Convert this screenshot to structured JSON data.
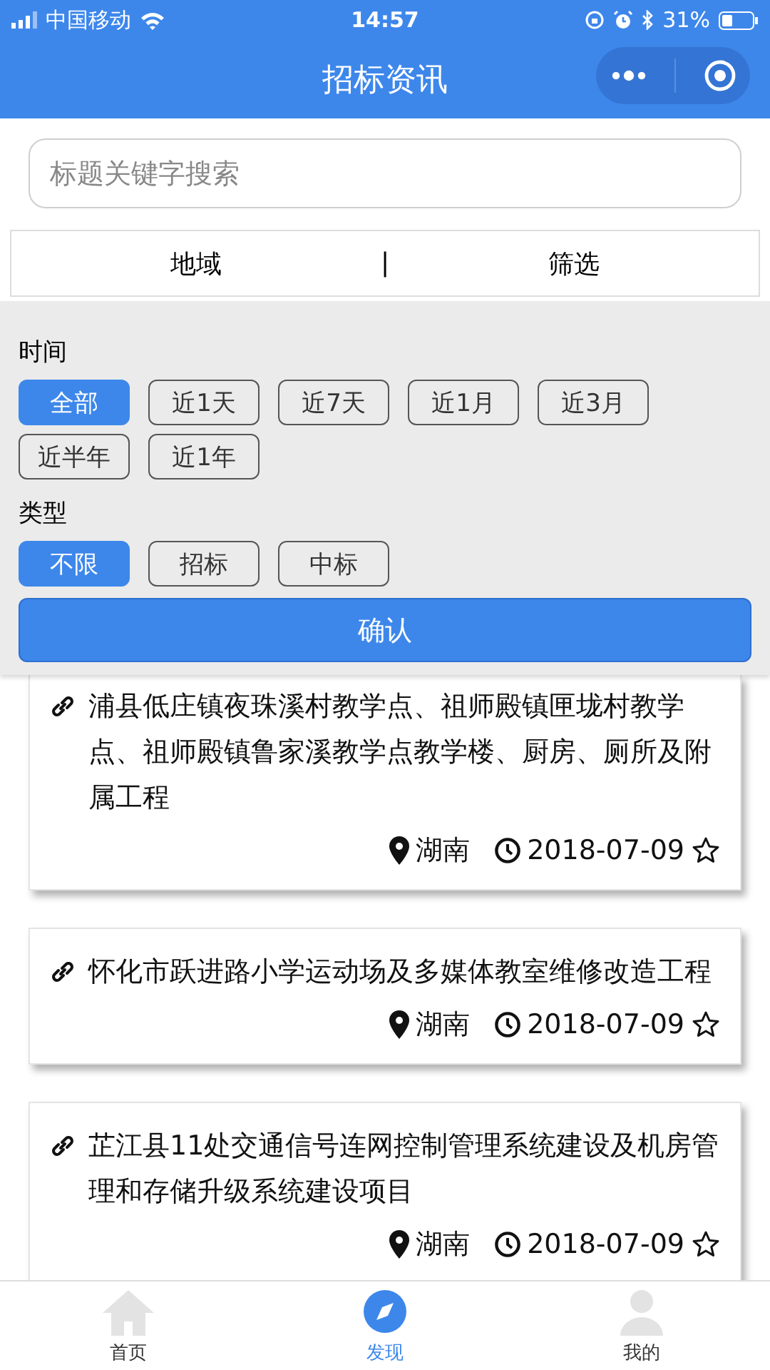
{
  "status_bar": {
    "carrier": "中国移动",
    "time": "14:57",
    "battery": "31%"
  },
  "nav": {
    "title": "招标资讯"
  },
  "search": {
    "placeholder": "标题关键字搜索"
  },
  "filter_bar": {
    "items": [
      "地域",
      "筛选"
    ],
    "divider": "|"
  },
  "filter_panel": {
    "time_label": "时间",
    "time_options": [
      {
        "label": "全部",
        "selected": true
      },
      {
        "label": "近1天",
        "selected": false
      },
      {
        "label": "近7天",
        "selected": false
      },
      {
        "label": "近1月",
        "selected": false
      },
      {
        "label": "近3月",
        "selected": false
      },
      {
        "label": "近半年",
        "selected": false
      },
      {
        "label": "近1年",
        "selected": false
      }
    ],
    "type_label": "类型",
    "type_options": [
      {
        "label": "不限",
        "selected": true
      },
      {
        "label": "招标",
        "selected": false
      },
      {
        "label": "中标",
        "selected": false
      }
    ],
    "confirm": "确认"
  },
  "listings": [
    {
      "title": "浦县低庄镇夜珠溪村教学点、祖师殿镇匣垅村教学点、祖师殿镇鲁家溪教学点教学楼、厨房、厕所及附属工程",
      "region": "湖南",
      "date": "2018-07-09",
      "starred": false
    },
    {
      "title": "怀化市跃进路小学运动场及多媒体教室维修改造工程",
      "region": "湖南",
      "date": "2018-07-09",
      "starred": false
    },
    {
      "title": "芷江县11处交通信号连网控制管理系统建设及机房管理和存储升级系统建设项目",
      "region": "湖南",
      "date": "2018-07-09",
      "starred": false
    }
  ],
  "tab_bar": [
    {
      "label": "首页",
      "selected": false
    },
    {
      "label": "发现",
      "selected": true
    },
    {
      "label": "我的",
      "selected": false
    }
  ]
}
